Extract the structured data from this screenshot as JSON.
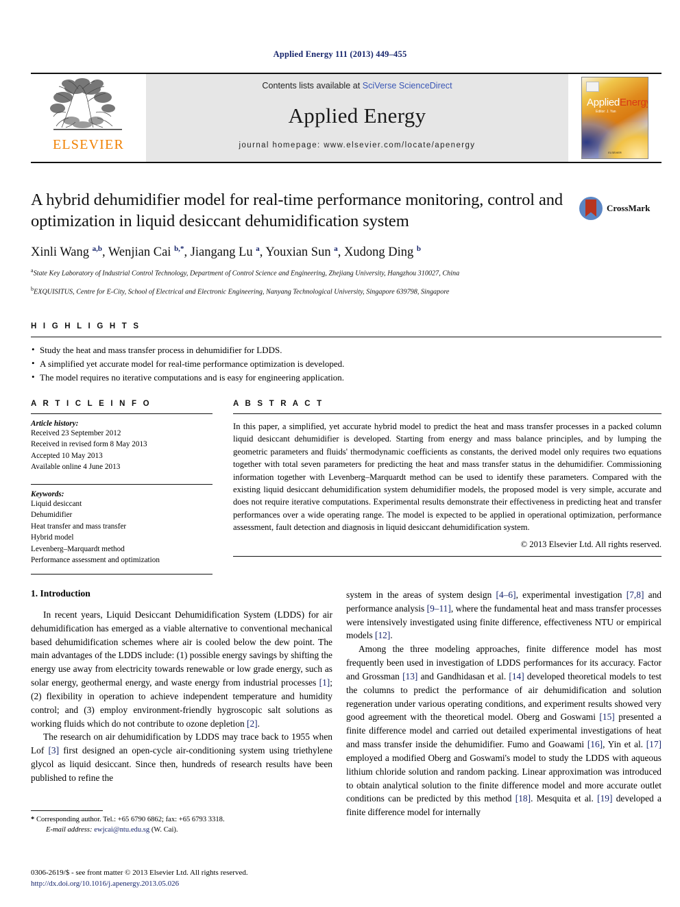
{
  "running_head": "Applied Energy 111 (2013) 449–455",
  "masthead": {
    "publisher_name": "ELSEVIER",
    "contents_prefix": "Contents lists available at ",
    "contents_link": "SciVerse ScienceDirect",
    "journal_title": "Applied Energy",
    "homepage": "journal homepage: www.elsevier.com/locate/apenergy",
    "cover": {
      "title_part1": "Applied",
      "title_part2": "Energy",
      "subtitle": "Editor: J. Yan",
      "footer": "ELSEVIER"
    }
  },
  "article": {
    "title": "A hybrid dehumidifier model for real-time performance monitoring, control and optimization in liquid desiccant dehumidification system",
    "crossmark_label": "CrossMark",
    "authors_html": "Xinli Wang <sup>a,b</sup>, Wenjian Cai <sup>b,</sup><sup>*</sup>, Jiangang Lu <sup>a</sup>, Youxian Sun <sup>a</sup>, Xudong Ding <sup>b</sup>",
    "affiliations": [
      {
        "marker": "a",
        "text": "State Key Laboratory of Industrial Control Technology, Department of Control Science and Engineering, Zhejiang University, Hangzhou 310027, China"
      },
      {
        "marker": "b",
        "text": "EXQUISITUS, Centre for E-City, School of Electrical and Electronic Engineering, Nanyang Technological University, Singapore 639798, Singapore"
      }
    ]
  },
  "highlights": {
    "heading": "H I G H L I G H T S",
    "items": [
      "Study the heat and mass transfer process in dehumidifier for LDDS.",
      "A simplified yet accurate model for real-time performance optimization is developed.",
      "The model requires no iterative computations and is easy for engineering application."
    ]
  },
  "article_info": {
    "heading": "A R T I C L E   I N F O",
    "history_label": "Article history:",
    "history": [
      "Received 23 September 2012",
      "Received in revised form 8 May 2013",
      "Accepted 10 May 2013",
      "Available online 4 June 2013"
    ],
    "keywords_label": "Keywords:",
    "keywords": [
      "Liquid desiccant",
      "Dehumidifier",
      "Heat transfer and mass transfer",
      "Hybrid model",
      "Levenberg–Marquardt method",
      "Performance assessment and optimization"
    ]
  },
  "abstract": {
    "heading": "A B S T R A C T",
    "text": "In this paper, a simplified, yet accurate hybrid model to predict the heat and mass transfer processes in a packed column liquid desiccant dehumidifier is developed. Starting from energy and mass balance principles, and by lumping the geometric parameters and fluids' thermodynamic coefficients as constants, the derived model only requires two equations together with total seven parameters for predicting the heat and mass transfer status in the dehumidifier. Commissioning information together with Levenberg–Marquardt method can be used to identify these parameters. Compared with the existing liquid desiccant dehumidification system dehumidifier models, the proposed model is very simple, accurate and does not require iterative computations. Experimental results demonstrate their effectiveness in predicting heat and transfer performances over a wide operating range. The model is expected to be applied in operational optimization, performance assessment, fault detection and diagnosis in liquid desiccant dehumidification system.",
    "copyright": "© 2013 Elsevier Ltd. All rights reserved."
  },
  "body": {
    "section_heading": "1. Introduction",
    "left_paragraphs": [
      "In recent years, Liquid Desiccant Dehumidification System (LDDS) for air dehumidification has emerged as a viable alternative to conventional mechanical based dehumidification schemes where air is cooled below the dew point. The main advantages of the LDDS include: (1) possible energy savings by shifting the energy use away from electricity towards renewable or low grade energy, such as solar energy, geothermal energy, and waste energy from industrial processes [1]; (2) flexibility in operation to achieve independent temperature and humidity control; and (3) employ environment-friendly hygroscopic salt solutions as working fluids which do not contribute to ozone depletion [2].",
      "The research on air dehumidification by LDDS may trace back to 1955 when Lof [3] first designed an open-cycle air-conditioning system using triethylene glycol as liquid desiccant. Since then, hundreds of research results have been published to refine the"
    ],
    "right_paragraphs": [
      "system in the areas of system design [4–6], experimental investigation [7,8] and performance analysis [9–11], where the fundamental heat and mass transfer processes were intensively investigated using finite difference, effectiveness NTU or empirical models [12].",
      "Among the three modeling approaches, finite difference model has most frequently been used in investigation of LDDS performances for its accuracy. Factor and Grossman [13] and Gandhidasan et al. [14] developed theoretical models to test the columns to predict the performance of air dehumidification and solution regeneration under various operating conditions, and experiment results showed very good agreement with the theoretical model. Oberg and Goswami [15] presented a finite difference model and carried out detailed experimental investigations of heat and mass transfer inside the dehumidifier. Fumo and Goawami [16], Yin et al. [17] employed a modified Oberg and Goswami's model to study the LDDS with aqueous lithium chloride solution and random packing. Linear approximation was introduced to obtain analytical solution to the finite difference model and more accurate outlet conditions can be predicted by this method [18]. Mesquita et al. [19] developed a finite difference model for internally"
    ]
  },
  "footnote": {
    "star": "*",
    "corresponding": "Corresponding author. Tel.: +65 6790 6862; fax: +65 6793 3318.",
    "email_label": "E-mail address:",
    "email": "ewjcai@ntu.edu.sg",
    "email_owner": "(W. Cai)."
  },
  "footer": {
    "issn_line": "0306-2619/$ - see front matter © 2013 Elsevier Ltd. All rights reserved.",
    "doi": "http://dx.doi.org/10.1016/j.apenergy.2013.05.026"
  },
  "colors": {
    "link_blue": "#16246b",
    "elsevier_orange": "#F08000",
    "masthead_grey": "#e6e6e6",
    "sciencedirect_blue": "#3a56b5"
  }
}
